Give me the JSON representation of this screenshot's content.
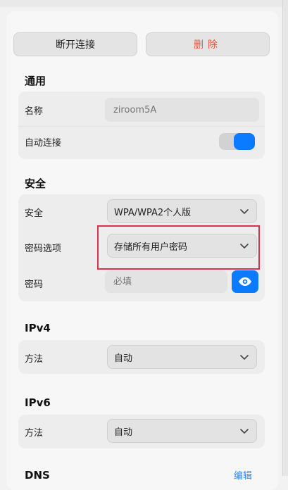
{
  "actions": {
    "disconnect_label": "断开连接",
    "delete_label": "删除"
  },
  "general": {
    "title": "通用",
    "name_label": "名称",
    "name_placeholder": "ziroom5A",
    "auto_connect_label": "自动连接",
    "auto_connect_on": true
  },
  "security": {
    "title": "安全",
    "security_label": "安全",
    "security_value": "WPA/WPA2个人版",
    "password_options_label": "密码选项",
    "password_options_value": "存储所有用户密码",
    "password_label": "密码",
    "password_placeholder": "必填"
  },
  "ipv4": {
    "title": "IPv4",
    "method_label": "方法",
    "method_value": "自动"
  },
  "ipv6": {
    "title": "IPv6",
    "method_label": "方法",
    "method_value": "自动"
  },
  "dns": {
    "title": "DNS",
    "edit_label": "编辑"
  },
  "icons": {
    "eye": "eye-icon",
    "chevron": "chevron-down-icon"
  },
  "colors": {
    "accent": "#0a7bff",
    "danger": "#f0523a",
    "highlight": "#e0304b"
  }
}
